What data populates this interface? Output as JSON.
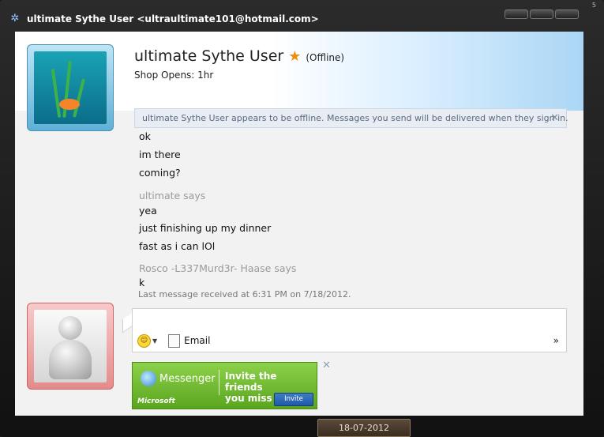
{
  "window": {
    "title": "ultimate Sythe User <ultraultimate101@hotmail.com>",
    "corner_text": "5"
  },
  "contact": {
    "name": "ultimate Sythe User",
    "status": "(Offline)",
    "personal_message": "Shop Opens: 1hr"
  },
  "offline_notice": "ultimate Sythe User appears to be offline. Messages you send will be delivered when they sign in.",
  "conversation": {
    "block1": [
      "ok",
      "im there",
      "coming?"
    ],
    "sender2": "ultimate says",
    "block2": [
      "yea",
      "just finishing up my dinner",
      "fast as i can lOl"
    ],
    "sender3": "Rosco -L337Murd3r- Haase says",
    "block3": [
      "k"
    ],
    "last_received": "Last message received at 6:31 PM on 7/18/2012."
  },
  "toolbar": {
    "emoticon_icon": "smiley-icon",
    "email_label": "Email",
    "more_label": "»"
  },
  "ad": {
    "brand": "Messenger",
    "tagline_line1": "Invite the friends",
    "tagline_line2": "you miss",
    "microsoft": "Microsoft",
    "button": "Invite"
  },
  "taskbar_date": "18-07-2012"
}
